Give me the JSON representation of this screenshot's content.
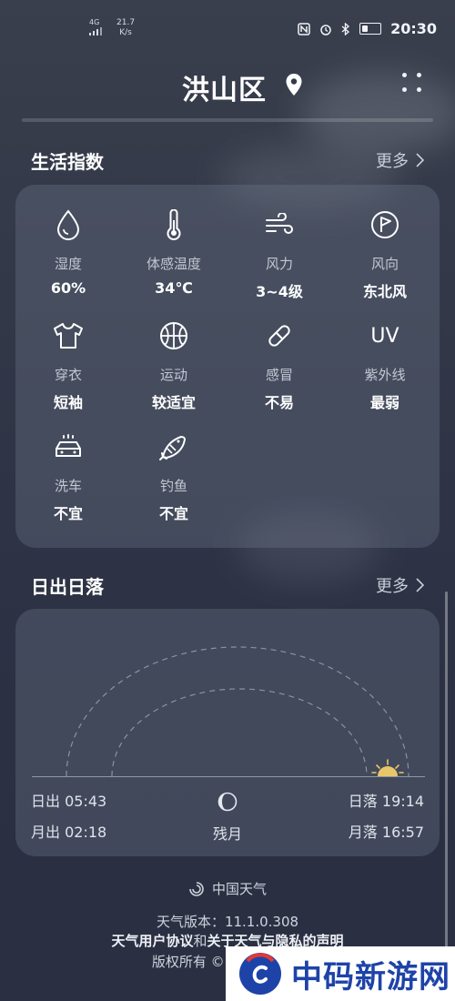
{
  "status_bar": {
    "network": "4G",
    "speed_value": "21.7",
    "speed_unit": "K/s",
    "time": "20:30"
  },
  "header": {
    "city": "洪山区"
  },
  "life_index": {
    "title": "生活指数",
    "more": "更多",
    "items": [
      {
        "icon": "droplet-icon",
        "label": "湿度",
        "value": "60%"
      },
      {
        "icon": "thermometer-icon",
        "label": "体感温度",
        "value": "34℃"
      },
      {
        "icon": "wind-icon",
        "label": "风力",
        "value": "3~4级"
      },
      {
        "icon": "wind-direction-icon",
        "label": "风向",
        "value": "东北风"
      },
      {
        "icon": "tshirt-icon",
        "label": "穿衣",
        "value": "短袖"
      },
      {
        "icon": "basketball-icon",
        "label": "运动",
        "value": "较适宜"
      },
      {
        "icon": "pill-icon",
        "label": "感冒",
        "value": "不易"
      },
      {
        "icon": "uv-icon",
        "icon_text": "UV",
        "label": "紫外线",
        "value": "最弱"
      },
      {
        "icon": "car-wash-icon",
        "label": "洗车",
        "value": "不宜"
      },
      {
        "icon": "fish-icon",
        "label": "钓鱼",
        "value": "不宜"
      }
    ]
  },
  "sunrise_sunset": {
    "title": "日出日落",
    "more": "更多",
    "sunrise": "日出 05:43",
    "sunset": "日落 19:14",
    "moonrise": "月出 02:18",
    "moonset": "月落 16:57",
    "moon_phase": "残月"
  },
  "footer": {
    "source": "中国天气",
    "version": "天气版本：11.1.0.308",
    "agreement_link1": "天气用户协议",
    "and_text": "和",
    "agreement_link2": "关于天气与隐私的声明",
    "copyright": "版权所有 © 2018-2021"
  },
  "watermark": {
    "text": "中码新游网"
  },
  "colors": {
    "background": "#2f3546",
    "card": "#4a5064",
    "accent_sun": "#e8c76a",
    "watermark_blue": "#1e43a8"
  }
}
